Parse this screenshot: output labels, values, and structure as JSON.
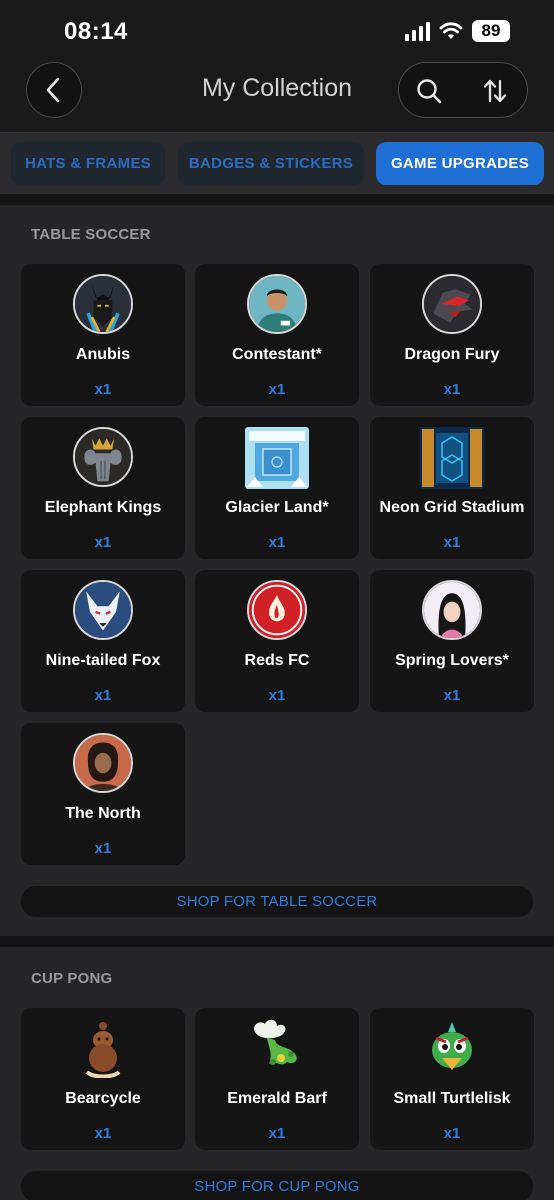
{
  "status_bar": {
    "time": "08:14",
    "battery": "89"
  },
  "header": {
    "title": "My Collection"
  },
  "tabs": [
    {
      "label": "HATS & FRAMES",
      "active": false
    },
    {
      "label": "BADGES & STICKERS",
      "active": false
    },
    {
      "label": "GAME UPGRADES",
      "active": true
    }
  ],
  "sections": [
    {
      "title": "TABLE SOCCER",
      "items": [
        {
          "name": "Anubis",
          "qty": "x1",
          "icon": "anubis-icon"
        },
        {
          "name": "Contestant*",
          "qty": "x1",
          "icon": "contestant-icon"
        },
        {
          "name": "Dragon Fury",
          "qty": "x1",
          "icon": "dragon-icon"
        },
        {
          "name": "Elephant Kings",
          "qty": "x1",
          "icon": "elephant-icon"
        },
        {
          "name": "Glacier Land*",
          "qty": "x1",
          "icon": "glacier-stadium-icon"
        },
        {
          "name": "Neon Grid Stadium",
          "qty": "x1",
          "icon": "neon-stadium-icon"
        },
        {
          "name": "Nine-tailed Fox",
          "qty": "x1",
          "icon": "fox-icon"
        },
        {
          "name": "Reds FC",
          "qty": "x1",
          "icon": "reds-crest-icon"
        },
        {
          "name": "Spring Lovers*",
          "qty": "x1",
          "icon": "spring-lovers-icon"
        },
        {
          "name": "The North",
          "qty": "x1",
          "icon": "the-north-icon"
        }
      ],
      "shop_label": "SHOP FOR TABLE SOCCER"
    },
    {
      "title": "CUP PONG",
      "items": [
        {
          "name": "Bearcycle",
          "qty": "x1",
          "icon": "bearcycle-icon"
        },
        {
          "name": "Emerald Barf",
          "qty": "x1",
          "icon": "emerald-barf-icon"
        },
        {
          "name": "Small Turtlelisk",
          "qty": "x1",
          "icon": "turtlelisk-icon"
        }
      ],
      "shop_label": "SHOP FOR CUP PONG"
    }
  ]
}
